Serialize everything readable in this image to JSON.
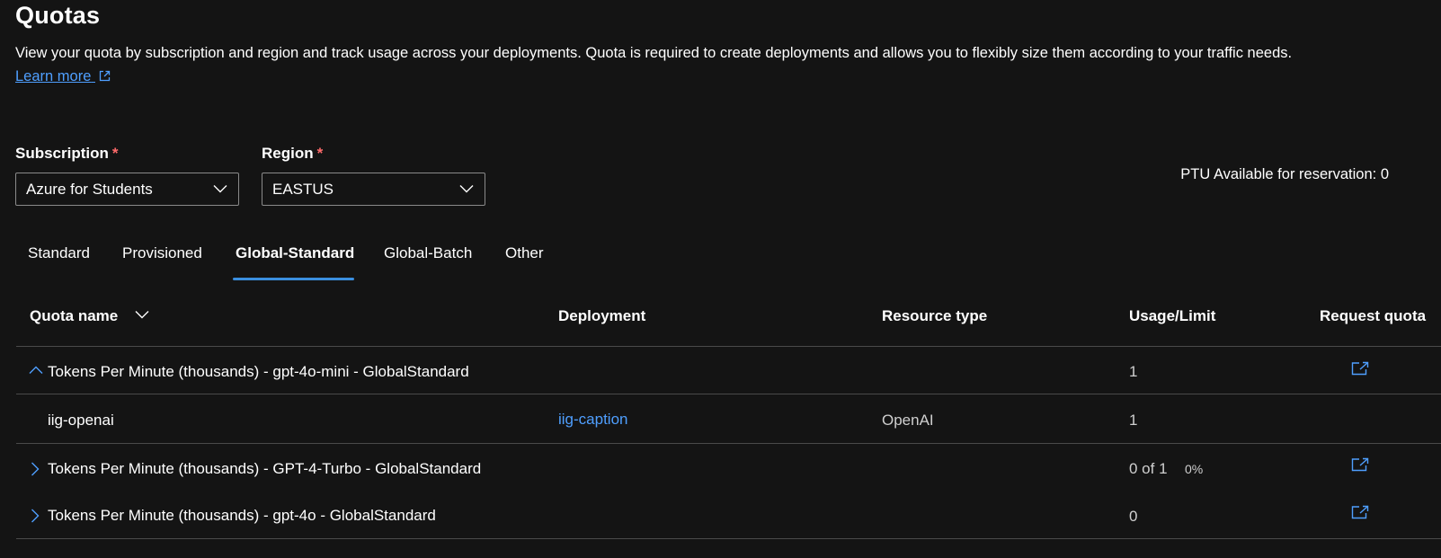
{
  "header": {
    "title": "Quotas",
    "description": "View your quota by subscription and region and track usage across your deployments. Quota is required to create deployments and allows you to flexibly size them according to your traffic needs.",
    "learn_more": "Learn more"
  },
  "filters": {
    "subscription_label": "Subscription",
    "subscription_value": "Azure for Students",
    "region_label": "Region",
    "region_value": "EASTUS",
    "required_mark": "*"
  },
  "ptu": "PTU Available for reservation: 0",
  "tabs": [
    {
      "label": "Standard"
    },
    {
      "label": "Provisioned"
    },
    {
      "label": "Global-Standard",
      "active": true
    },
    {
      "label": "Global-Batch"
    },
    {
      "label": "Other"
    }
  ],
  "table": {
    "columns": [
      "Quota name",
      "Deployment",
      "Resource type",
      "Usage/Limit",
      "Request quota"
    ],
    "rows": [
      {
        "name": "Tokens Per Minute (thousands) - gpt-4o-mini - GlobalStandard",
        "usage": "1",
        "expanded": true
      },
      {
        "name": "iig-openai",
        "deployment": "iig-caption",
        "resource_type": "OpenAI",
        "usage": "1"
      },
      {
        "name": "Tokens Per Minute (thousands) - GPT-4-Turbo - GlobalStandard",
        "usage": "0 of 1",
        "percent": "0%"
      },
      {
        "name": "Tokens Per Minute (thousands) - gpt-4o - GlobalStandard",
        "usage": "0"
      }
    ]
  },
  "colors": {
    "background": "#141414",
    "accent": "#3a8fe0",
    "link": "#4f9fff",
    "required": "#ff6b6b"
  }
}
